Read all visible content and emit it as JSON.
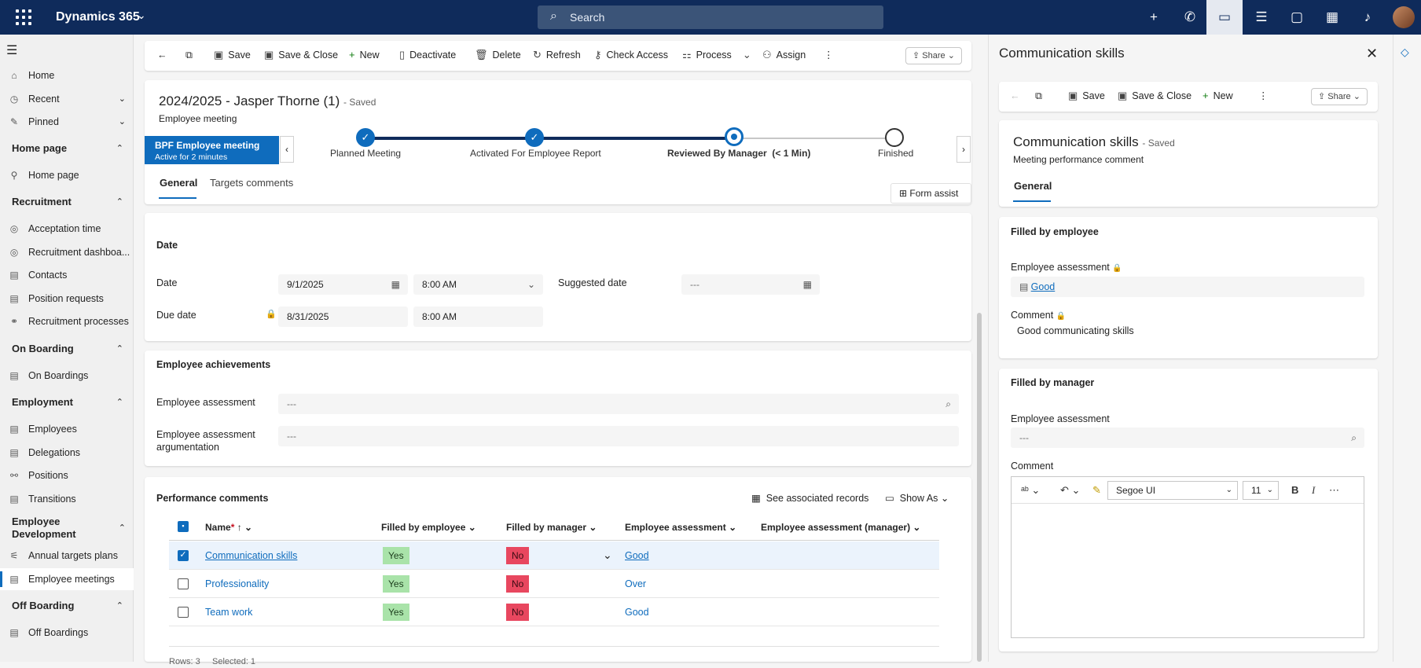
{
  "app": {
    "name": "Dynamics 365",
    "search_placeholder": "Search"
  },
  "nav": {
    "top": [
      {
        "label": "Home",
        "icon": "home-icon"
      },
      {
        "label": "Recent",
        "icon": "clock-icon"
      },
      {
        "label": "Pinned",
        "icon": "pin-icon"
      }
    ],
    "sections": [
      {
        "title": "Home page",
        "items": [
          "Home page"
        ]
      },
      {
        "title": "Recruitment",
        "items": [
          "Acceptation time",
          "Recruitment dashboa...",
          "Contacts",
          "Position requests",
          "Recruitment processes"
        ]
      },
      {
        "title": "On Boarding",
        "items": [
          "On Boardings"
        ]
      },
      {
        "title": "Employment",
        "items": [
          "Employees",
          "Delegations",
          "Positions",
          "Transitions"
        ]
      },
      {
        "title": "Employee Development",
        "items": [
          "Annual targets plans",
          "Employee meetings"
        ]
      },
      {
        "title": "Off Boarding",
        "items": [
          "Off Boardings"
        ]
      }
    ]
  },
  "main": {
    "commands": [
      "Save",
      "Save & Close",
      "New",
      "Deactivate",
      "Delete",
      "Refresh",
      "Check Access",
      "Process",
      "Assign"
    ],
    "share": "Share",
    "title": "2024/2025 - Jasper Thorne (1)",
    "saved": "- Saved",
    "entity": "Employee meeting",
    "bpf": {
      "name": "BPF Employee meeting",
      "active": "Active for 2 minutes",
      "stages": [
        "Planned Meeting",
        "Activated For Employee Report",
        "Reviewed By Manager",
        "Finished"
      ],
      "current_time": "(< 1 Min)"
    },
    "tabs": [
      "General",
      "Targets comments"
    ],
    "form_assist": "Form assist",
    "date_section": {
      "title": "Date",
      "date_label": "Date",
      "date_value": "9/1/2025",
      "time_value": "8:00 AM",
      "suggested_label": "Suggested date",
      "suggested_value": "---",
      "due_label": "Due date",
      "due_value": "8/31/2025",
      "due_time": "8:00 AM"
    },
    "achievements": {
      "title": "Employee achievements",
      "assess_label": "Employee assessment",
      "assess_value": "---",
      "arg_label": "Employee assessment argumentation",
      "arg_value": "---"
    },
    "perf": {
      "title": "Performance comments",
      "see_assoc": "See associated records",
      "show_as": "Show As",
      "columns": [
        "Name",
        "Filled by employee",
        "Filled by manager",
        "Employee assessment",
        "Employee assessment (manager)"
      ],
      "rows": [
        {
          "name": "Communication skills",
          "emp": "Yes",
          "mgr": "No",
          "assess": "Good",
          "selected": true
        },
        {
          "name": "Professionality",
          "emp": "Yes",
          "mgr": "No",
          "assess": "Over",
          "selected": false
        },
        {
          "name": "Team work",
          "emp": "Yes",
          "mgr": "No",
          "assess": "Good",
          "selected": false
        }
      ],
      "footer": "Rows: 3     Selected: 1"
    }
  },
  "panel": {
    "header": "Communication skills",
    "commands": [
      "Save",
      "Save & Close",
      "New"
    ],
    "share": "Share",
    "title": "Communication skills",
    "saved": "- Saved",
    "entity": "Meeting performance comment",
    "tab": "General",
    "emp": {
      "title": "Filled by employee",
      "assess_label": "Employee assessment",
      "assess_value": "Good",
      "comment_label": "Comment",
      "comment_value": "Good communicating skills"
    },
    "mgr": {
      "title": "Filled by manager",
      "assess_label": "Employee assessment",
      "assess_value": "---",
      "comment_label": "Comment",
      "font": "Segoe UI",
      "size": "11"
    }
  }
}
